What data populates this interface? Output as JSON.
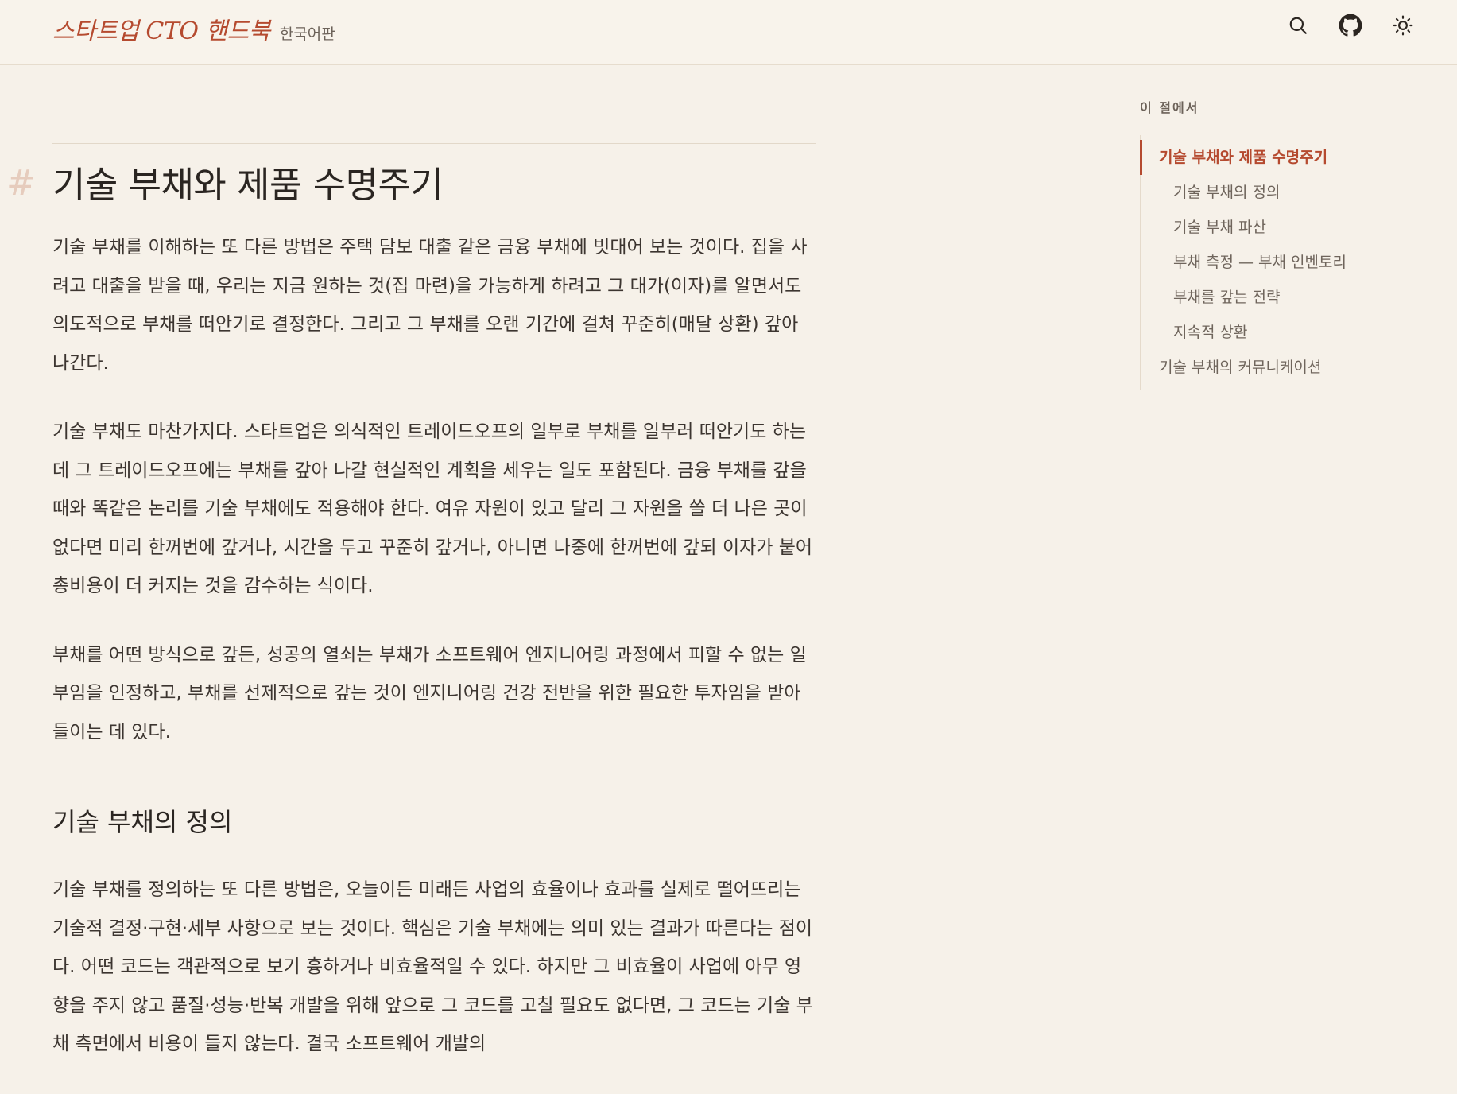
{
  "header": {
    "brand_title": "스타트업 CTO 핸드북",
    "brand_subtitle": "한국어판",
    "icons": [
      "search-icon",
      "github-icon",
      "sun-icon"
    ]
  },
  "article": {
    "anchor": "#",
    "title": "기술 부채와 제품 수명주기",
    "paragraphs": [
      "기술 부채를 이해하는 또 다른 방법은 주택 담보 대출 같은 금융 부채에 빗대어 보는 것이다. 집을 사려고 대출을 받을 때, 우리는 지금 원하는 것(집 마련)을 가능하게 하려고 그 대가(이자)를 알면서도 의도적으로 부채를 떠안기로 결정한다. 그리고 그 부채를 오랜 기간에 걸쳐 꾸준히(매달 상환) 갚아 나간다.",
      "기술 부채도 마찬가지다. 스타트업은 의식적인 트레이드오프의 일부로 부채를 일부러 떠안기도 하는데 그 트레이드오프에는 부채를 갚아 나갈 현실적인 계획을 세우는 일도 포함된다. 금융 부채를 갚을 때와 똑같은 논리를 기술 부채에도 적용해야 한다. 여유 자원이 있고 달리 그 자원을 쓸 더 나은 곳이 없다면 미리 한꺼번에 갚거나, 시간을 두고 꾸준히 갚거나, 아니면 나중에 한꺼번에 갚되 이자가 붙어 총비용이 더 커지는 것을 감수하는 식이다.",
      "부채를 어떤 방식으로 갚든, 성공의 열쇠는 부채가 소프트웨어 엔지니어링 과정에서 피할 수 없는 일부임을 인정하고, 부채를 선제적으로 갚는 것이 엔지니어링 건강 전반을 위한 필요한 투자임을 받아들이는 데 있다."
    ],
    "section_title": "기술 부채의 정의",
    "section_paragraph": "기술 부채를 정의하는 또 다른 방법은, 오늘이든 미래든 사업의 효율이나 효과를 실제로 떨어뜨리는 기술적 결정·구현·세부 사항으로 보는 것이다. 핵심은 기술 부채에는 의미 있는 결과가 따른다는 점이다. 어떤 코드는 객관적으로 보기 흉하거나 비효율적일 수 있다. 하지만 그 비효율이 사업에 아무 영향을 주지 않고 품질·성능·반복 개발을 위해 앞으로 그 코드를 고칠 필요도 없다면, 그 코드는 기술 부채 측면에서 비용이 들지 않는다. 결국 소프트웨어 개발의"
  },
  "toc": {
    "title": "이 절에서",
    "items": [
      {
        "label": "기술 부채와 제품 수명주기",
        "level": 1,
        "active": true
      },
      {
        "label": "기술 부채의 정의",
        "level": 2
      },
      {
        "label": "기술 부채 파산",
        "level": 2
      },
      {
        "label": "부채 측정 — 부채 인벤토리",
        "level": 2
      },
      {
        "label": "부채를 갚는 전략",
        "level": 2
      },
      {
        "label": "지속적 상환",
        "level": 2
      },
      {
        "label": "기술 부채의 커뮤니케이션",
        "level": 1
      }
    ]
  },
  "colors": {
    "accent": "#b54a2f",
    "background": "#f6f1e9",
    "text": "#3c3530"
  }
}
